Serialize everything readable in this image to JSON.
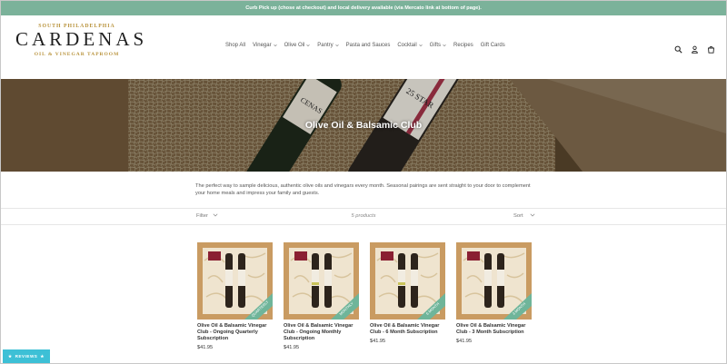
{
  "announcement": "Curb Pick up (chose at checkout) and local delivery available (via Mercato link at bottom of page).",
  "logo": {
    "top_text": "SOUTH PHILADELPHIA",
    "name": "CARDENAS",
    "bottom_text": "OIL & VINEGAR TAPROOM"
  },
  "nav": [
    {
      "label": "Shop All",
      "dropdown": false
    },
    {
      "label": "Vinegar",
      "dropdown": true
    },
    {
      "label": "Olive Oil",
      "dropdown": true
    },
    {
      "label": "Pantry",
      "dropdown": true
    },
    {
      "label": "Pasta and Sauces",
      "dropdown": false
    },
    {
      "label": "Cocktail",
      "dropdown": true
    },
    {
      "label": "Gifts",
      "dropdown": true
    },
    {
      "label": "Recipes",
      "dropdown": false
    },
    {
      "label": "Gift Cards",
      "dropdown": false
    }
  ],
  "header_icons": [
    "search-icon",
    "account-icon",
    "cart-icon"
  ],
  "hero": {
    "title": "Olive Oil & Balsamic Club",
    "bottle_label_text": "CENAS",
    "bottle_label_text2": "25 STAR"
  },
  "description": "The perfect way to sample delicious, authentic olive oils and vinegars every month. Seasonal pairings are sent straight to your door to complement your home meals and impress your family and guests.",
  "filter_bar": {
    "filter_label": "Filter",
    "count": "5 products",
    "sort_label": "Sort"
  },
  "products": [
    {
      "title": "Olive Oil & Balsamic Vinegar Club - Ongoing Quarterly Subscription",
      "price": "$41.95",
      "ribbon": "QUARTERLY"
    },
    {
      "title": "Olive Oil & Balsamic Vinegar Club - Ongoing Monthly Subscription",
      "price": "$41.95",
      "ribbon": "MONTHLY"
    },
    {
      "title": "Olive Oil & Balsamic Vinegar Club - 6 Month Subscription",
      "price": "$41.95",
      "ribbon": "6 MONTH"
    },
    {
      "title": "Olive Oil & Balsamic Vinegar Club - 3 Month Subscription",
      "price": "$41.95",
      "ribbon": "3 MONTH"
    }
  ],
  "reviews_tab": "REVIEWS",
  "colors": {
    "announcement_bg": "#7bb29a",
    "logo_gold": "#b8923a",
    "ribbon": "#6fb59a",
    "reviews_tab": "#3dc0d6"
  }
}
